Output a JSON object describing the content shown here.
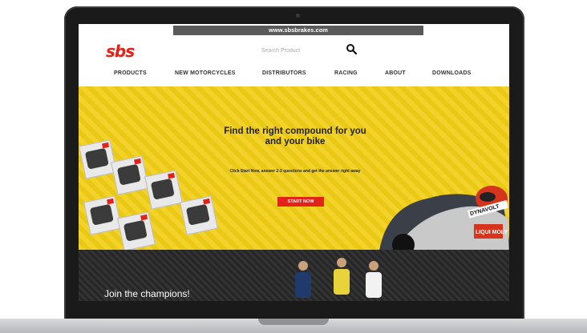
{
  "browser": {
    "url": "www.sbsbrakes.com"
  },
  "header": {
    "logo_text": "sbs",
    "search_placeholder": "Search Product"
  },
  "nav": {
    "items": [
      "PRODUCTS",
      "NEW MOTORCYCLES",
      "DISTRIBUTORS",
      "RACING",
      "ABOUT",
      "DOWNLOADS"
    ]
  },
  "hero": {
    "title": "Find the right compound for you and your bike",
    "subtitle": "Click Start Now, answer 2-3 questions and get the answer right away",
    "button_label": "START NOW",
    "rider_text_1": "DYNAVOLT",
    "rider_text_2": "LIQUI MOLY"
  },
  "champions": {
    "title": "Join the champions!"
  },
  "colors": {
    "brand_red": "#e2231a",
    "hero_yellow": "#f2cf17",
    "dark_band": "#2b2b2b"
  }
}
